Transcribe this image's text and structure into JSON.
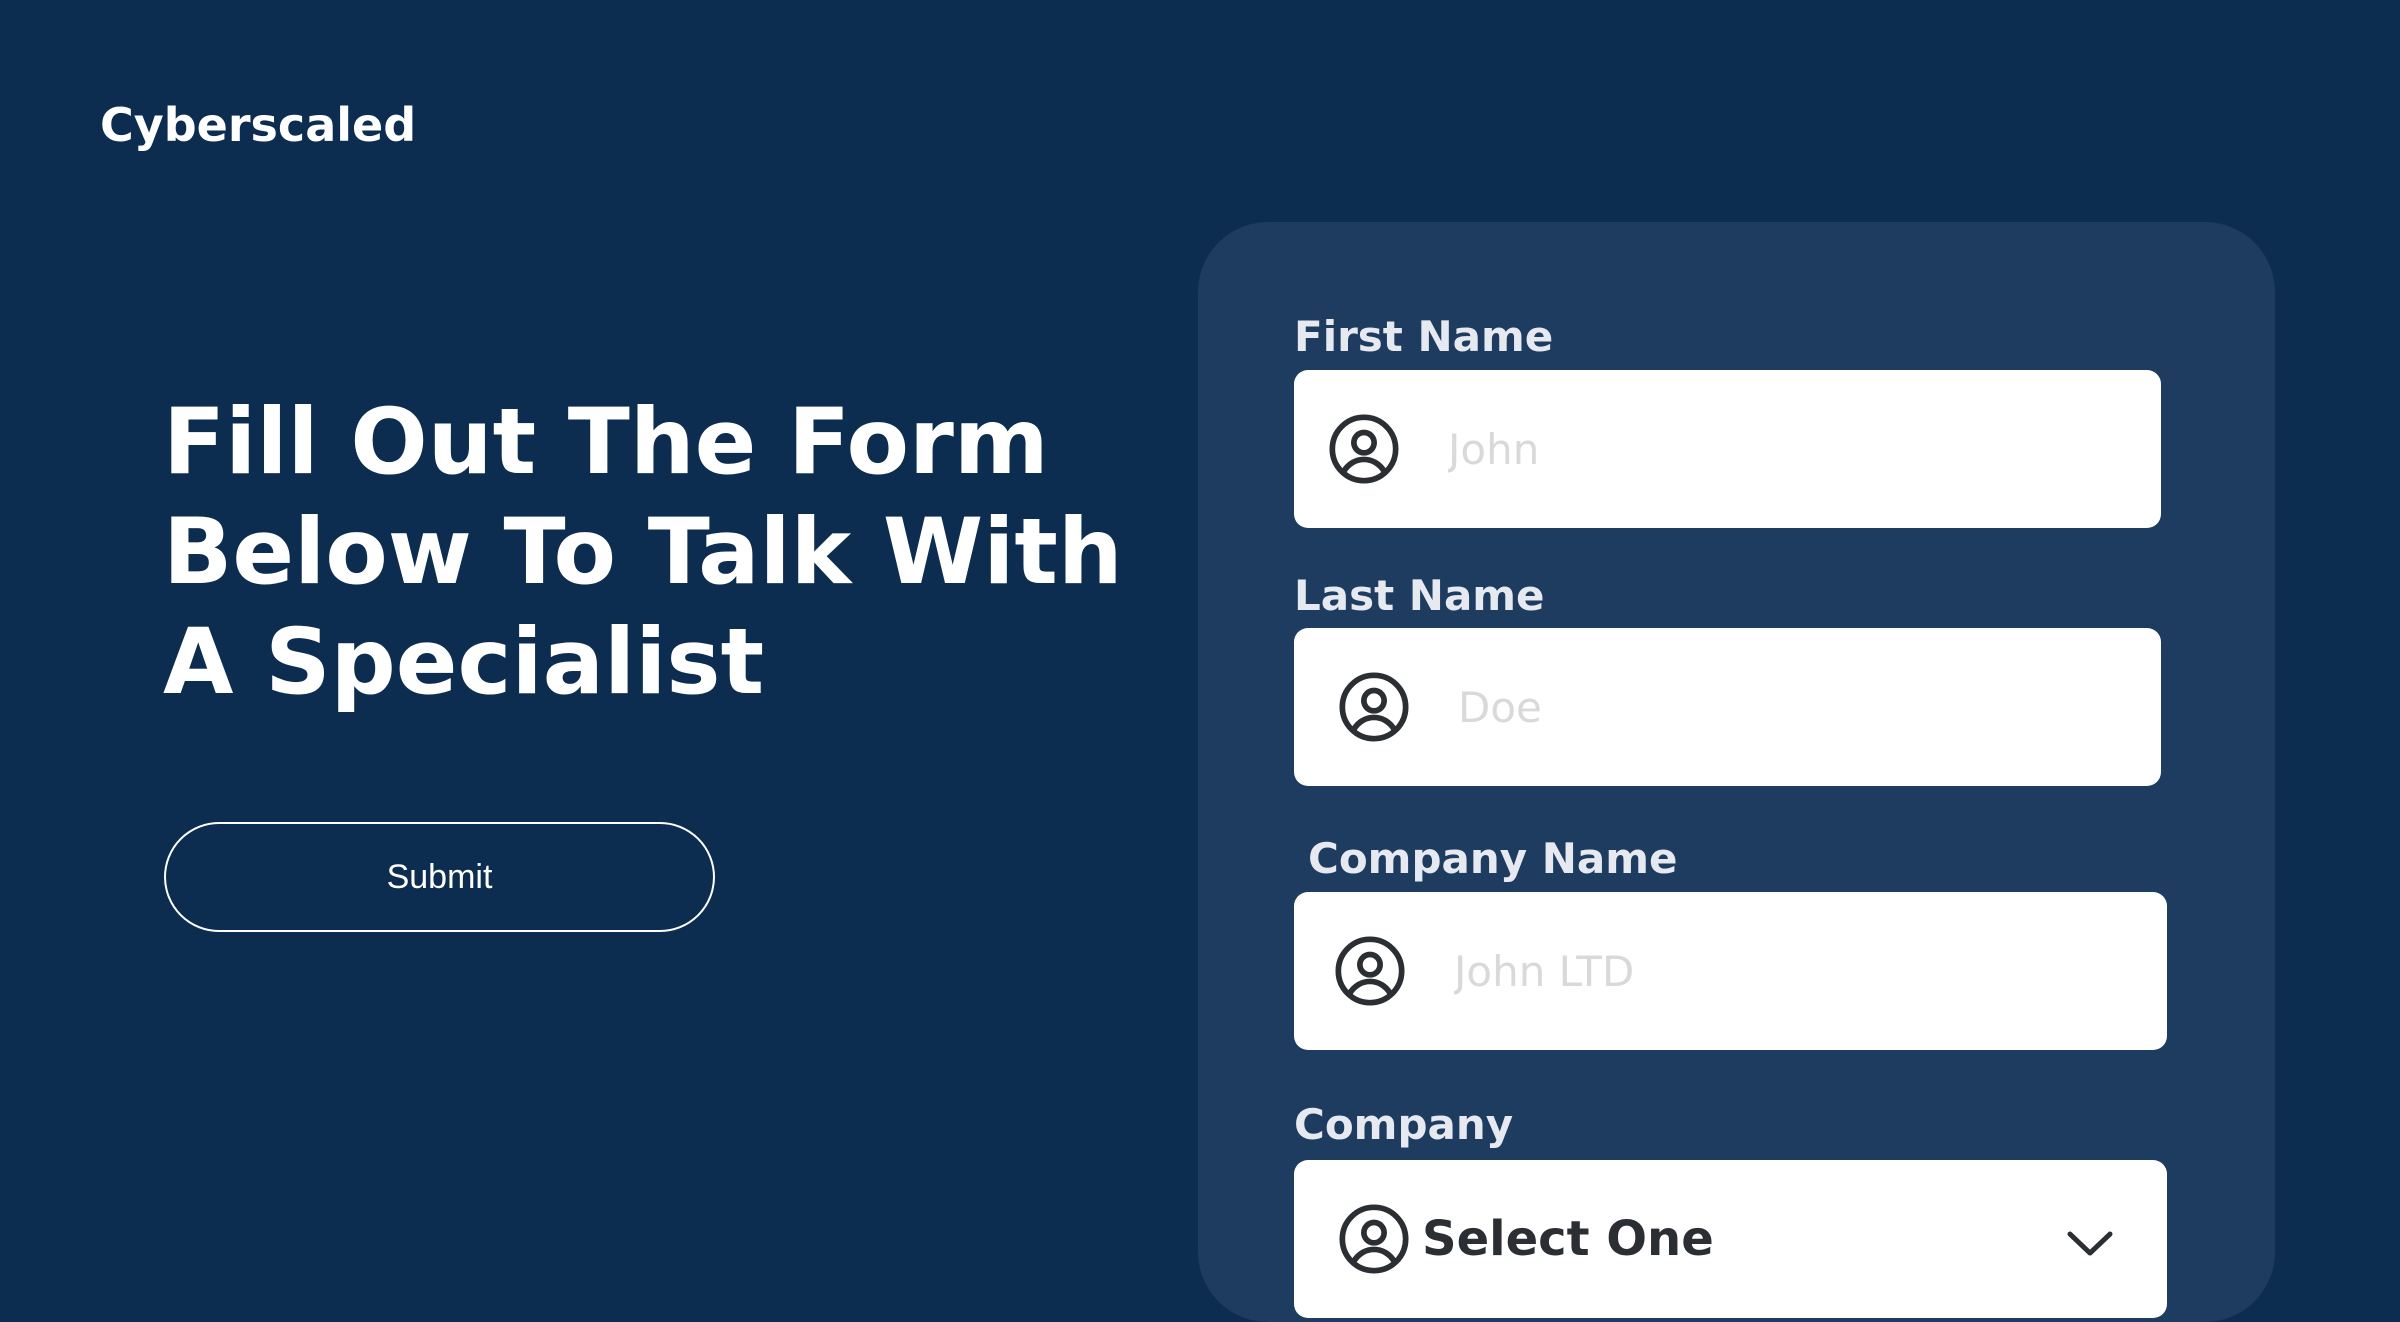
{
  "brand": {
    "name": "Cyberscaled"
  },
  "hero": {
    "headline": "Fill Out The Form\nBelow  To Talk With\nA Specialist",
    "submit_label": "Submit"
  },
  "form": {
    "first_name": {
      "label": "First Name",
      "placeholder": "John",
      "icon": "user-circle-icon"
    },
    "last_name": {
      "label": "Last Name",
      "placeholder": "Doe",
      "icon": "user-circle-icon"
    },
    "company_name": {
      "label": "Company Name",
      "placeholder": "John LTD",
      "icon": "user-circle-icon"
    },
    "company": {
      "label": "Company",
      "selected": "Select One",
      "icon": "user-circle-icon",
      "dropdown_icon": "chevron-down-icon"
    }
  },
  "colors": {
    "background": "#0d2d50",
    "card": "#1e3b60",
    "label": "#e6eaf0",
    "input_bg": "#ffffff",
    "placeholder": "#d9d9d9",
    "icon": "#2b2f33"
  }
}
